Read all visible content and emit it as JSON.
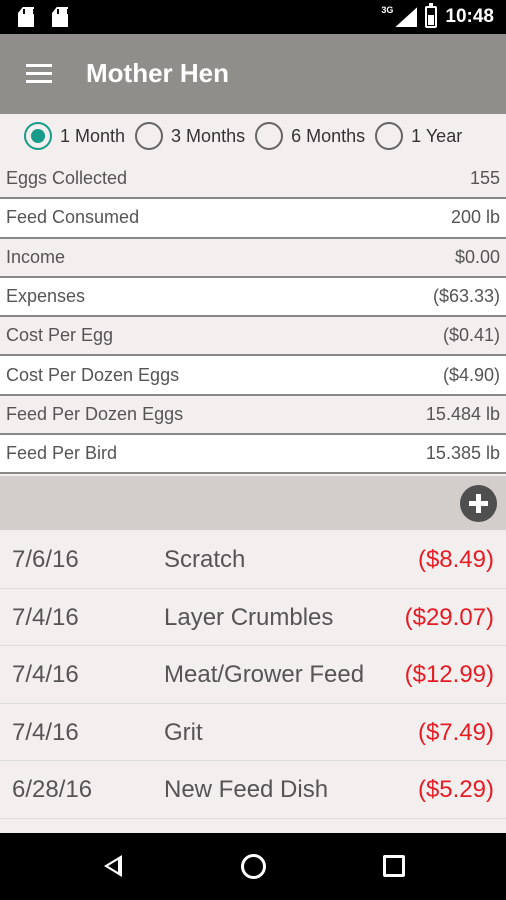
{
  "status_bar": {
    "network": "3G",
    "time": "10:48"
  },
  "app": {
    "title": "Mother Hen"
  },
  "range_options": [
    {
      "label": "1 Month",
      "selected": true
    },
    {
      "label": "3 Months",
      "selected": false
    },
    {
      "label": "6 Months",
      "selected": false
    },
    {
      "label": "1 Year",
      "selected": false
    }
  ],
  "stats": [
    {
      "label": "Eggs Collected",
      "value": "155"
    },
    {
      "label": "Feed Consumed",
      "value": "200 lb"
    },
    {
      "label": "Income",
      "value": "$0.00"
    },
    {
      "label": "Expenses",
      "value": "($63.33)"
    },
    {
      "label": "Cost Per Egg",
      "value": "($0.41)"
    },
    {
      "label": "Cost Per Dozen Eggs",
      "value": "($4.90)"
    },
    {
      "label": "Feed Per Dozen Eggs",
      "value": "15.484 lb"
    },
    {
      "label": "Feed Per Bird",
      "value": "15.385 lb"
    }
  ],
  "expenses": [
    {
      "date": "7/6/16",
      "name": "Scratch",
      "amount": "($8.49)"
    },
    {
      "date": "7/4/16",
      "name": "Layer Crumbles",
      "amount": "($29.07)"
    },
    {
      "date": "7/4/16",
      "name": "Meat/Grower Feed",
      "amount": "($12.99)"
    },
    {
      "date": "7/4/16",
      "name": "Grit",
      "amount": "($7.49)"
    },
    {
      "date": "6/28/16",
      "name": "New Feed Dish",
      "amount": "($5.29)"
    }
  ],
  "colors": {
    "accent": "#169c88",
    "app_bar": "#8f8e8a",
    "negative": "#e51c23"
  },
  "icons": {
    "menu": "menu-icon",
    "add": "add-icon",
    "back": "back-icon",
    "home": "home-icon",
    "recents": "recents-icon"
  }
}
